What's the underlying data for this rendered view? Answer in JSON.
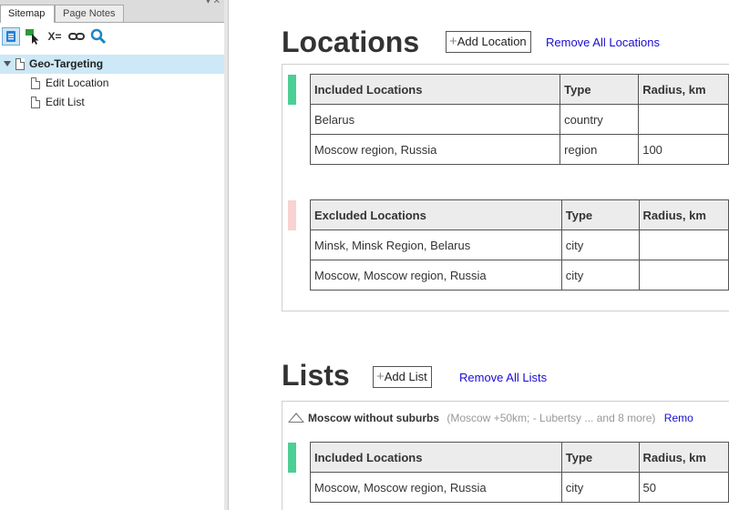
{
  "sidebar": {
    "tabs": [
      {
        "label": "Sitemap"
      },
      {
        "label": "Page Notes"
      }
    ],
    "panel_controls": "▾ ✕",
    "toolbar": [
      {
        "icon": "sitemap-page-icon"
      },
      {
        "icon": "add-page-icon"
      },
      {
        "icon": "variables-icon",
        "label": "X="
      },
      {
        "icon": "link-icon"
      },
      {
        "icon": "search-icon"
      }
    ],
    "tree": [
      {
        "label": "Geo-Targeting",
        "level": 0,
        "selected": true,
        "expanded": true
      },
      {
        "label": "Edit Location",
        "level": 1
      },
      {
        "label": "Edit List",
        "level": 1
      }
    ]
  },
  "locations": {
    "title": "Locations",
    "add_button": "Add Location",
    "add_plus": "+",
    "remove_all": "Remove All Locations",
    "included": {
      "marker_color": "#4ccf94",
      "headers": [
        "Included Locations",
        "Type",
        "Radius, km"
      ],
      "rows": [
        [
          "Belarus",
          "country",
          ""
        ],
        [
          "Moscow region, Russia",
          "region",
          "100"
        ]
      ]
    },
    "excluded": {
      "marker_color": "#f8d3d1",
      "headers": [
        "Excluded Locations",
        "Type",
        "Radius, km"
      ],
      "rows": [
        [
          "Minsk, Minsk Region, Belarus",
          "city",
          ""
        ],
        [
          "Moscow, Moscow region, Russia",
          "city",
          ""
        ]
      ]
    }
  },
  "lists": {
    "title": "Lists",
    "add_button": "Add List",
    "add_plus": "+",
    "remove_all": "Remove All Lists",
    "items": [
      {
        "name": "Moscow without suburbs",
        "summary": "(Moscow +50km; - Lubertsy ... and 8 more)",
        "action": "Remo",
        "included": {
          "marker_color": "#4ccf94",
          "headers": [
            "Included Locations",
            "Type",
            "Radius, km"
          ],
          "rows": [
            [
              "Moscow, Moscow region, Russia",
              "city",
              "50"
            ]
          ]
        }
      }
    ]
  }
}
